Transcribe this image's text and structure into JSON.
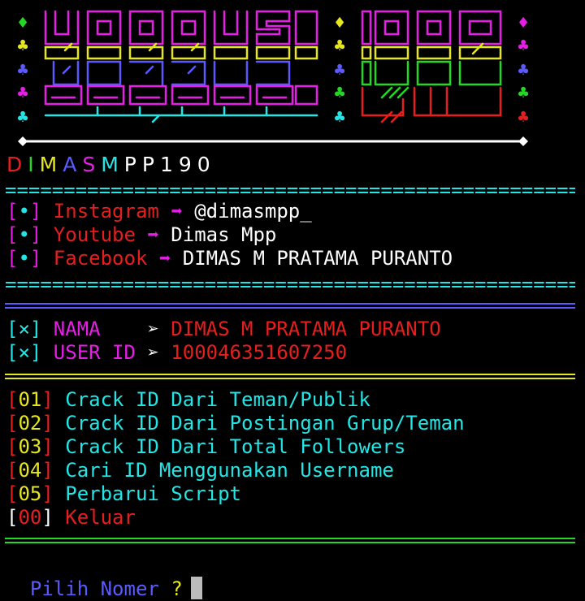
{
  "colors": {
    "cyan": "#22e6e6",
    "magenta": "#e61ee6",
    "red": "#e61e1e",
    "yellow": "#e6e61e",
    "green": "#22d822",
    "blue": "#5a5aff",
    "white": "#ffffff"
  },
  "author": {
    "letters": [
      "D",
      "I",
      "M",
      "A",
      "S",
      "M",
      "P",
      "P",
      "1",
      "9",
      "0"
    ],
    "letter_colors": [
      "#e61e1e",
      "#22d822",
      "#e6e61e",
      "#5a5aff",
      "#e61ee6",
      "#22e6e6",
      "#ffffff",
      "#ffffff",
      "#ffffff",
      "#ffffff",
      "#ffffff"
    ]
  },
  "separator_char": "=",
  "social": [
    {
      "bracket_open": "[",
      "bullet": "•",
      "bracket_close": "]",
      "label": "Instagram",
      "arrow": "➡",
      "value": "@dimasmpp_"
    },
    {
      "bracket_open": "[",
      "bullet": "•",
      "bracket_close": "]",
      "label": "Youtube",
      "arrow": "➡",
      "value": "Dimas Mpp"
    },
    {
      "bracket_open": "[",
      "bullet": "•",
      "bracket_close": "]",
      "label": "Facebook",
      "arrow": "➡",
      "value": "DIMAS M PRATAMA PURANTO"
    }
  ],
  "user": [
    {
      "mark": "[×]",
      "label": "NAMA   ",
      "arrow": "➢",
      "value": "DIMAS M PRATAMA PURANTO"
    },
    {
      "mark": "[×]",
      "label": "USER ID",
      "arrow": "➢",
      "value": "100046351607250"
    }
  ],
  "menu": [
    {
      "open": "[",
      "num": "01",
      "close": "]",
      "label": "Crack ID Dari Teman/Publik"
    },
    {
      "open": "[",
      "num": "02",
      "close": "]",
      "label": "Crack ID Dari Postingan Grup/Teman"
    },
    {
      "open": "[",
      "num": "03",
      "close": "]",
      "label": "Crack ID Dari Total Followers"
    },
    {
      "open": "[",
      "num": "04",
      "close": "]",
      "label": "Cari ID Menggunakan Username"
    },
    {
      "open": "[",
      "num": "05",
      "close": "]",
      "label": "Perbarui Script"
    },
    {
      "open": "[",
      "num": "00",
      "close": "]",
      "label": "Keluar"
    }
  ],
  "prompt": {
    "label": "Pilih Nomer",
    "mark": "?"
  }
}
